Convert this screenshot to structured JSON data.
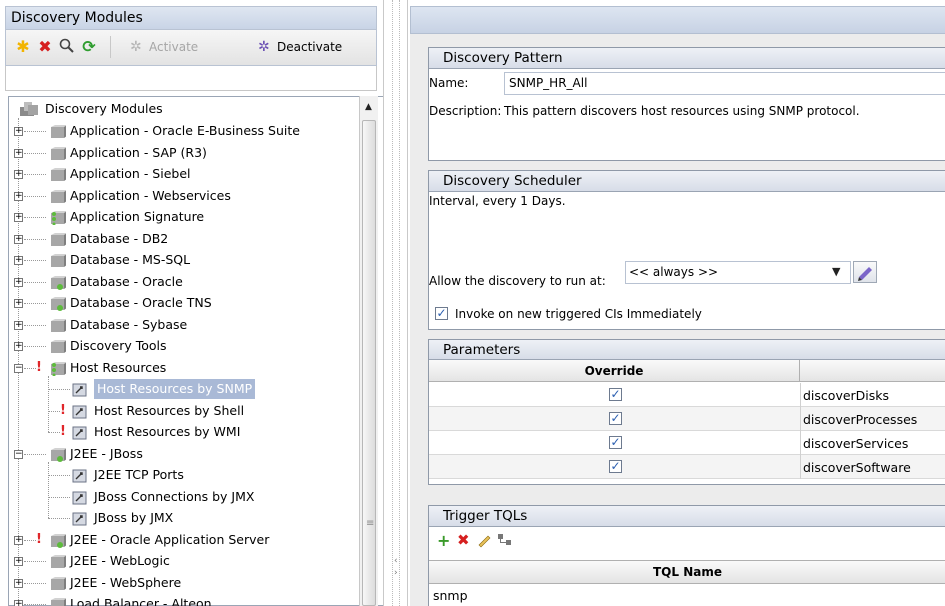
{
  "left_panel": {
    "title": "Discovery Modules",
    "toolbar": {
      "activate_label": "Activate",
      "deactivate_label": "Deactivate"
    }
  },
  "tree": {
    "root_label": "Discovery Modules",
    "items": [
      {
        "label": "Application - Oracle E-Business Suite"
      },
      {
        "label": "Application - SAP (R3)"
      },
      {
        "label": "Application - Siebel"
      },
      {
        "label": "Application - Webservices"
      },
      {
        "label": "Application Signature"
      },
      {
        "label": "Database - DB2"
      },
      {
        "label": "Database - MS-SQL"
      },
      {
        "label": "Database - Oracle"
      },
      {
        "label": "Database - Oracle TNS"
      },
      {
        "label": "Database - Sybase"
      },
      {
        "label": "Discovery Tools"
      },
      {
        "label": "Host Resources"
      },
      {
        "label": "Host Resources by SNMP"
      },
      {
        "label": "Host Resources by Shell"
      },
      {
        "label": "Host Resources by WMI"
      },
      {
        "label": "J2EE - JBoss"
      },
      {
        "label": "J2EE TCP Ports"
      },
      {
        "label": "JBoss Connections by JMX"
      },
      {
        "label": "JBoss by JMX"
      },
      {
        "label": "J2EE - Oracle Application Server"
      },
      {
        "label": "J2EE - WebLogic"
      },
      {
        "label": "J2EE - WebSphere"
      },
      {
        "label": "Load Balancer - Alteon"
      }
    ]
  },
  "discovery_pattern": {
    "title": "Discovery Pattern",
    "name_label": "Name:",
    "name_value": "SNMP_HR_All",
    "description_label": "Description:",
    "description_value": "This pattern discovers host resources using SNMP protocol."
  },
  "discovery_scheduler": {
    "title": "Discovery Scheduler",
    "interval_text": "Interval, every 1 Days.",
    "allow_label": "Allow the discovery to run at:",
    "allow_value": "<< always >>",
    "invoke_label": "Invoke on new triggered CIs Immediately",
    "invoke_checked": true
  },
  "parameters": {
    "title": "Parameters",
    "override_header": "Override",
    "rows": [
      {
        "override": true,
        "name": "discoverDisks"
      },
      {
        "override": true,
        "name": "discoverProcesses"
      },
      {
        "override": true,
        "name": "discoverServices"
      },
      {
        "override": true,
        "name": "discoverSoftware"
      }
    ]
  },
  "trigger_tqls": {
    "title": "Trigger TQLs",
    "column_header": "TQL Name",
    "rows": [
      "snmp"
    ]
  },
  "colors": {
    "selection": "#a9b9d6",
    "header_blue": "#c7d2e4",
    "add_green": "#3a9a2a",
    "delete_red": "#d62020"
  }
}
